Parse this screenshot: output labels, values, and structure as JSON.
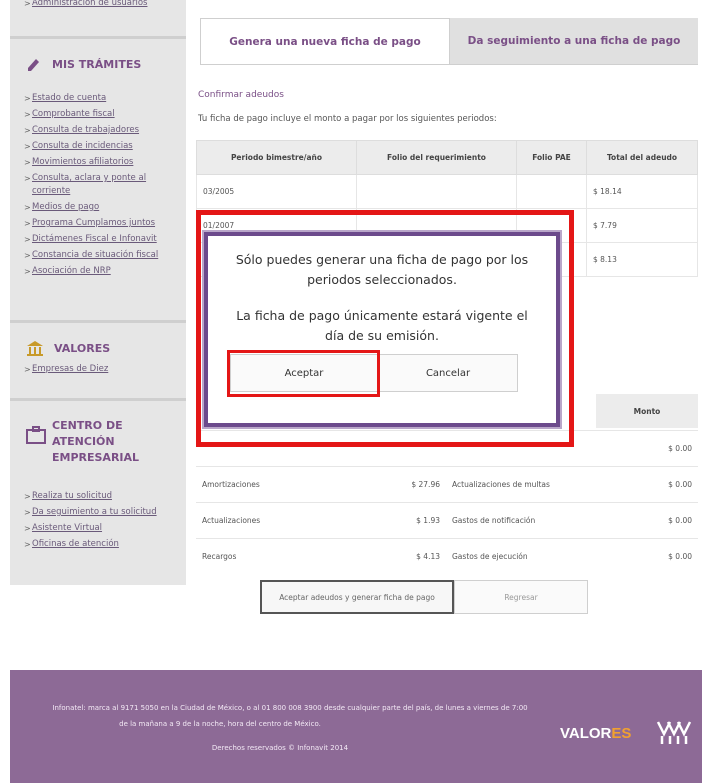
{
  "sidebar": {
    "top_link": "Administración de usuarios",
    "mis_tramites": {
      "title": "MIS TRÁMITES",
      "items": [
        {
          "label": "Estado de cuenta"
        },
        {
          "label": "Comprobante fiscal"
        },
        {
          "label": "Consulta de trabajadores"
        },
        {
          "label": "Consulta de incidencias"
        },
        {
          "label": "Movimientos afiliatorios"
        },
        {
          "label": "Consulta, aclara y ponte al"
        },
        {
          "label": "corriente"
        },
        {
          "label": "Medios de pago"
        },
        {
          "label": "Programa Cumplamos juntos"
        },
        {
          "label": "Dictámenes Fiscal e Infonavit"
        },
        {
          "label": "Constancia de situación fiscal"
        },
        {
          "label": "Asociación de NRP"
        }
      ]
    },
    "valores": {
      "title": "VALORES",
      "items": [
        {
          "label": "Empresas de Diez"
        }
      ]
    },
    "centro": {
      "title_line1": "CENTRO DE ATENCIÓN",
      "title_line2": "EMPRESARIAL",
      "items": [
        {
          "label": "Realiza tu solicitud"
        },
        {
          "label": "Da seguimiento a tu solicitud"
        },
        {
          "label": "Asistente Virtual"
        },
        {
          "label": "Oficinas de atención"
        }
      ]
    }
  },
  "tabs": {
    "tab1": "Genera una nueva ficha de pago",
    "tab2": "Da seguimiento a una ficha de pago"
  },
  "main": {
    "section_title": "Confirmar adeudos",
    "intro": "Tu ficha de pago incluye el monto a pagar por los siguientes periodos:",
    "table_headers": [
      "Periodo bimestre/año",
      "Folio del requerimiento",
      "Folio PAE",
      "Total del adeudo"
    ],
    "rows": [
      {
        "period": "03/2005",
        "total": "$ 18.14"
      },
      {
        "period": "01/2007",
        "total": "$ 7.79"
      },
      {
        "period": "",
        "total": "$ 8.13"
      }
    ],
    "monto_header": "Monto",
    "conceptos": [
      {
        "left_label": "",
        "left_value": "",
        "right_label": "",
        "right_value": "$ 0.00"
      },
      {
        "left_label": "Amortizaciones",
        "left_value": "$ 27.96",
        "right_label": "Actualizaciones de multas",
        "right_value": "$ 0.00"
      },
      {
        "left_label": "Actualizaciones",
        "left_value": "$ 1.93",
        "right_label": "Gastos de notificación",
        "right_value": "$ 0.00"
      },
      {
        "left_label": "Recargos",
        "left_value": "$ 4.13",
        "right_label": "Gastos de ejecución",
        "right_value": "$ 0.00"
      }
    ],
    "accept_button": "Aceptar adeudos y generar ficha de pago",
    "back_button": "Regresar"
  },
  "dialog": {
    "message1_line1": "Sólo puedes generar una ficha de pago por los",
    "message1_line2": "periodos seleccionados.",
    "message2_line1": "La ficha de pago únicamente estará vigente el",
    "message2_line2": "día de su emisión.",
    "accept": "Aceptar",
    "cancel": "Cancelar"
  },
  "footer": {
    "line1": "Infonatel: marca al 9171 5050 en la Ciudad de México, o al 01 800 008 3900 desde cualquier parte del país, de lunes a viernes de 7:00",
    "line2": "de la mañana a 9 de la noche, hora del centro de México.",
    "copyright": "Derechos reservados © Infonavit 2014",
    "brand_part1": "VALOR",
    "brand_part2": "ES"
  },
  "colors": {
    "accent": "#7a4f86",
    "highlight": "#e41616",
    "footer_bg": "#8d6a96",
    "brand_orange": "#f0a030"
  }
}
